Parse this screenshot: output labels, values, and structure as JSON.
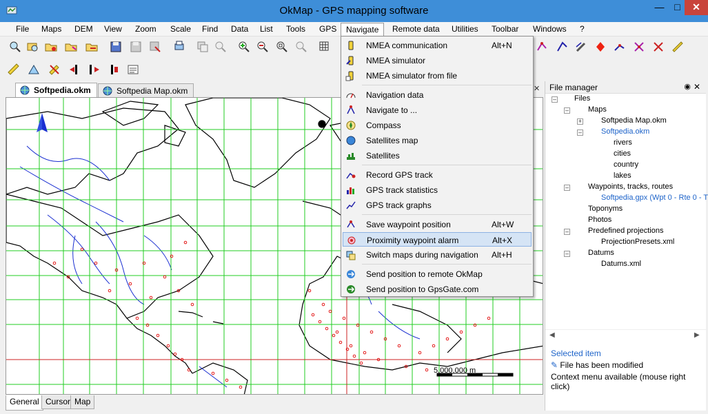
{
  "window": {
    "title": "OkMap - GPS mapping software"
  },
  "menubar": [
    "File",
    "Maps",
    "DEM",
    "View",
    "Zoom",
    "Scale",
    "Find",
    "Data",
    "List",
    "Tools",
    "GPS",
    "Navigate",
    "Remote data",
    "Utilities",
    "Toolbar",
    "Windows",
    "?"
  ],
  "doc_tabs": [
    "Softpedia.okm",
    "Softpedia Map.okm"
  ],
  "navigate_menu": {
    "items": [
      {
        "label": "NMEA communication",
        "shortcut": "Alt+N",
        "icon": "nmea-icon"
      },
      {
        "label": "NMEA simulator",
        "shortcut": "",
        "icon": "nmea-sim-icon"
      },
      {
        "label": "NMEA simulator from file",
        "shortcut": "",
        "icon": "nmea-file-icon"
      },
      {
        "label": "Navigation data",
        "shortcut": "",
        "icon": "speedometer-icon"
      },
      {
        "label": "Navigate to ...",
        "shortcut": "",
        "icon": "navigate-to-icon"
      },
      {
        "label": "Compass",
        "shortcut": "",
        "icon": "compass-icon"
      },
      {
        "label": "Satellites map",
        "shortcut": "",
        "icon": "globe-icon"
      },
      {
        "label": "Satellites",
        "shortcut": "",
        "icon": "satellite-icon"
      },
      {
        "label": "Record GPS track",
        "shortcut": "",
        "icon": "record-track-icon"
      },
      {
        "label": "GPS track statistics",
        "shortcut": "",
        "icon": "statistics-icon"
      },
      {
        "label": "GPS track graphs",
        "shortcut": "",
        "icon": "graph-icon"
      },
      {
        "label": "Save waypoint position",
        "shortcut": "Alt+W",
        "icon": "save-waypoint-icon"
      },
      {
        "label": "Proximity waypoint alarm",
        "shortcut": "Alt+X",
        "icon": "alarm-icon"
      },
      {
        "label": "Switch maps during navigation",
        "shortcut": "Alt+H",
        "icon": "switch-maps-icon"
      },
      {
        "label": "Send position to remote OkMap",
        "shortcut": "",
        "icon": "send-remote-icon"
      },
      {
        "label": "Send position to GpsGate.com",
        "shortcut": "",
        "icon": "send-gpsgate-icon"
      }
    ],
    "highlighted": "Proximity waypoint alarm"
  },
  "file_manager": {
    "title": "File manager",
    "tree": [
      {
        "label": "Files"
      },
      {
        "label": "Maps"
      },
      {
        "label": "Softpedia Map.okm"
      },
      {
        "label": "Softpedia.okm"
      },
      {
        "label": "rivers"
      },
      {
        "label": "cities"
      },
      {
        "label": "country"
      },
      {
        "label": "lakes"
      },
      {
        "label": "Waypoints, tracks, routes"
      },
      {
        "label": "Softpedia.gpx (Wpt 0 - Rte 0 - T"
      },
      {
        "label": "Toponyms"
      },
      {
        "label": "Photos"
      },
      {
        "label": "Predefined projections"
      },
      {
        "label": "ProjectionPresets.xml"
      },
      {
        "label": "Datums"
      },
      {
        "label": "Datums.xml"
      }
    ],
    "selected_label": "Selected item",
    "info1": "File has been modified",
    "info2": "Context menu available (mouse right click)"
  },
  "bottom_tabs": [
    "General",
    "Cursor",
    "Map"
  ],
  "map": {
    "scale_label": "5,000,000 m"
  },
  "colors": {
    "titlebar": "#3e8ed8",
    "grid_green": "#22cc22",
    "river_blue": "#1a2fd1",
    "city_red": "#e00000",
    "highlight": "#d5e4f5"
  }
}
